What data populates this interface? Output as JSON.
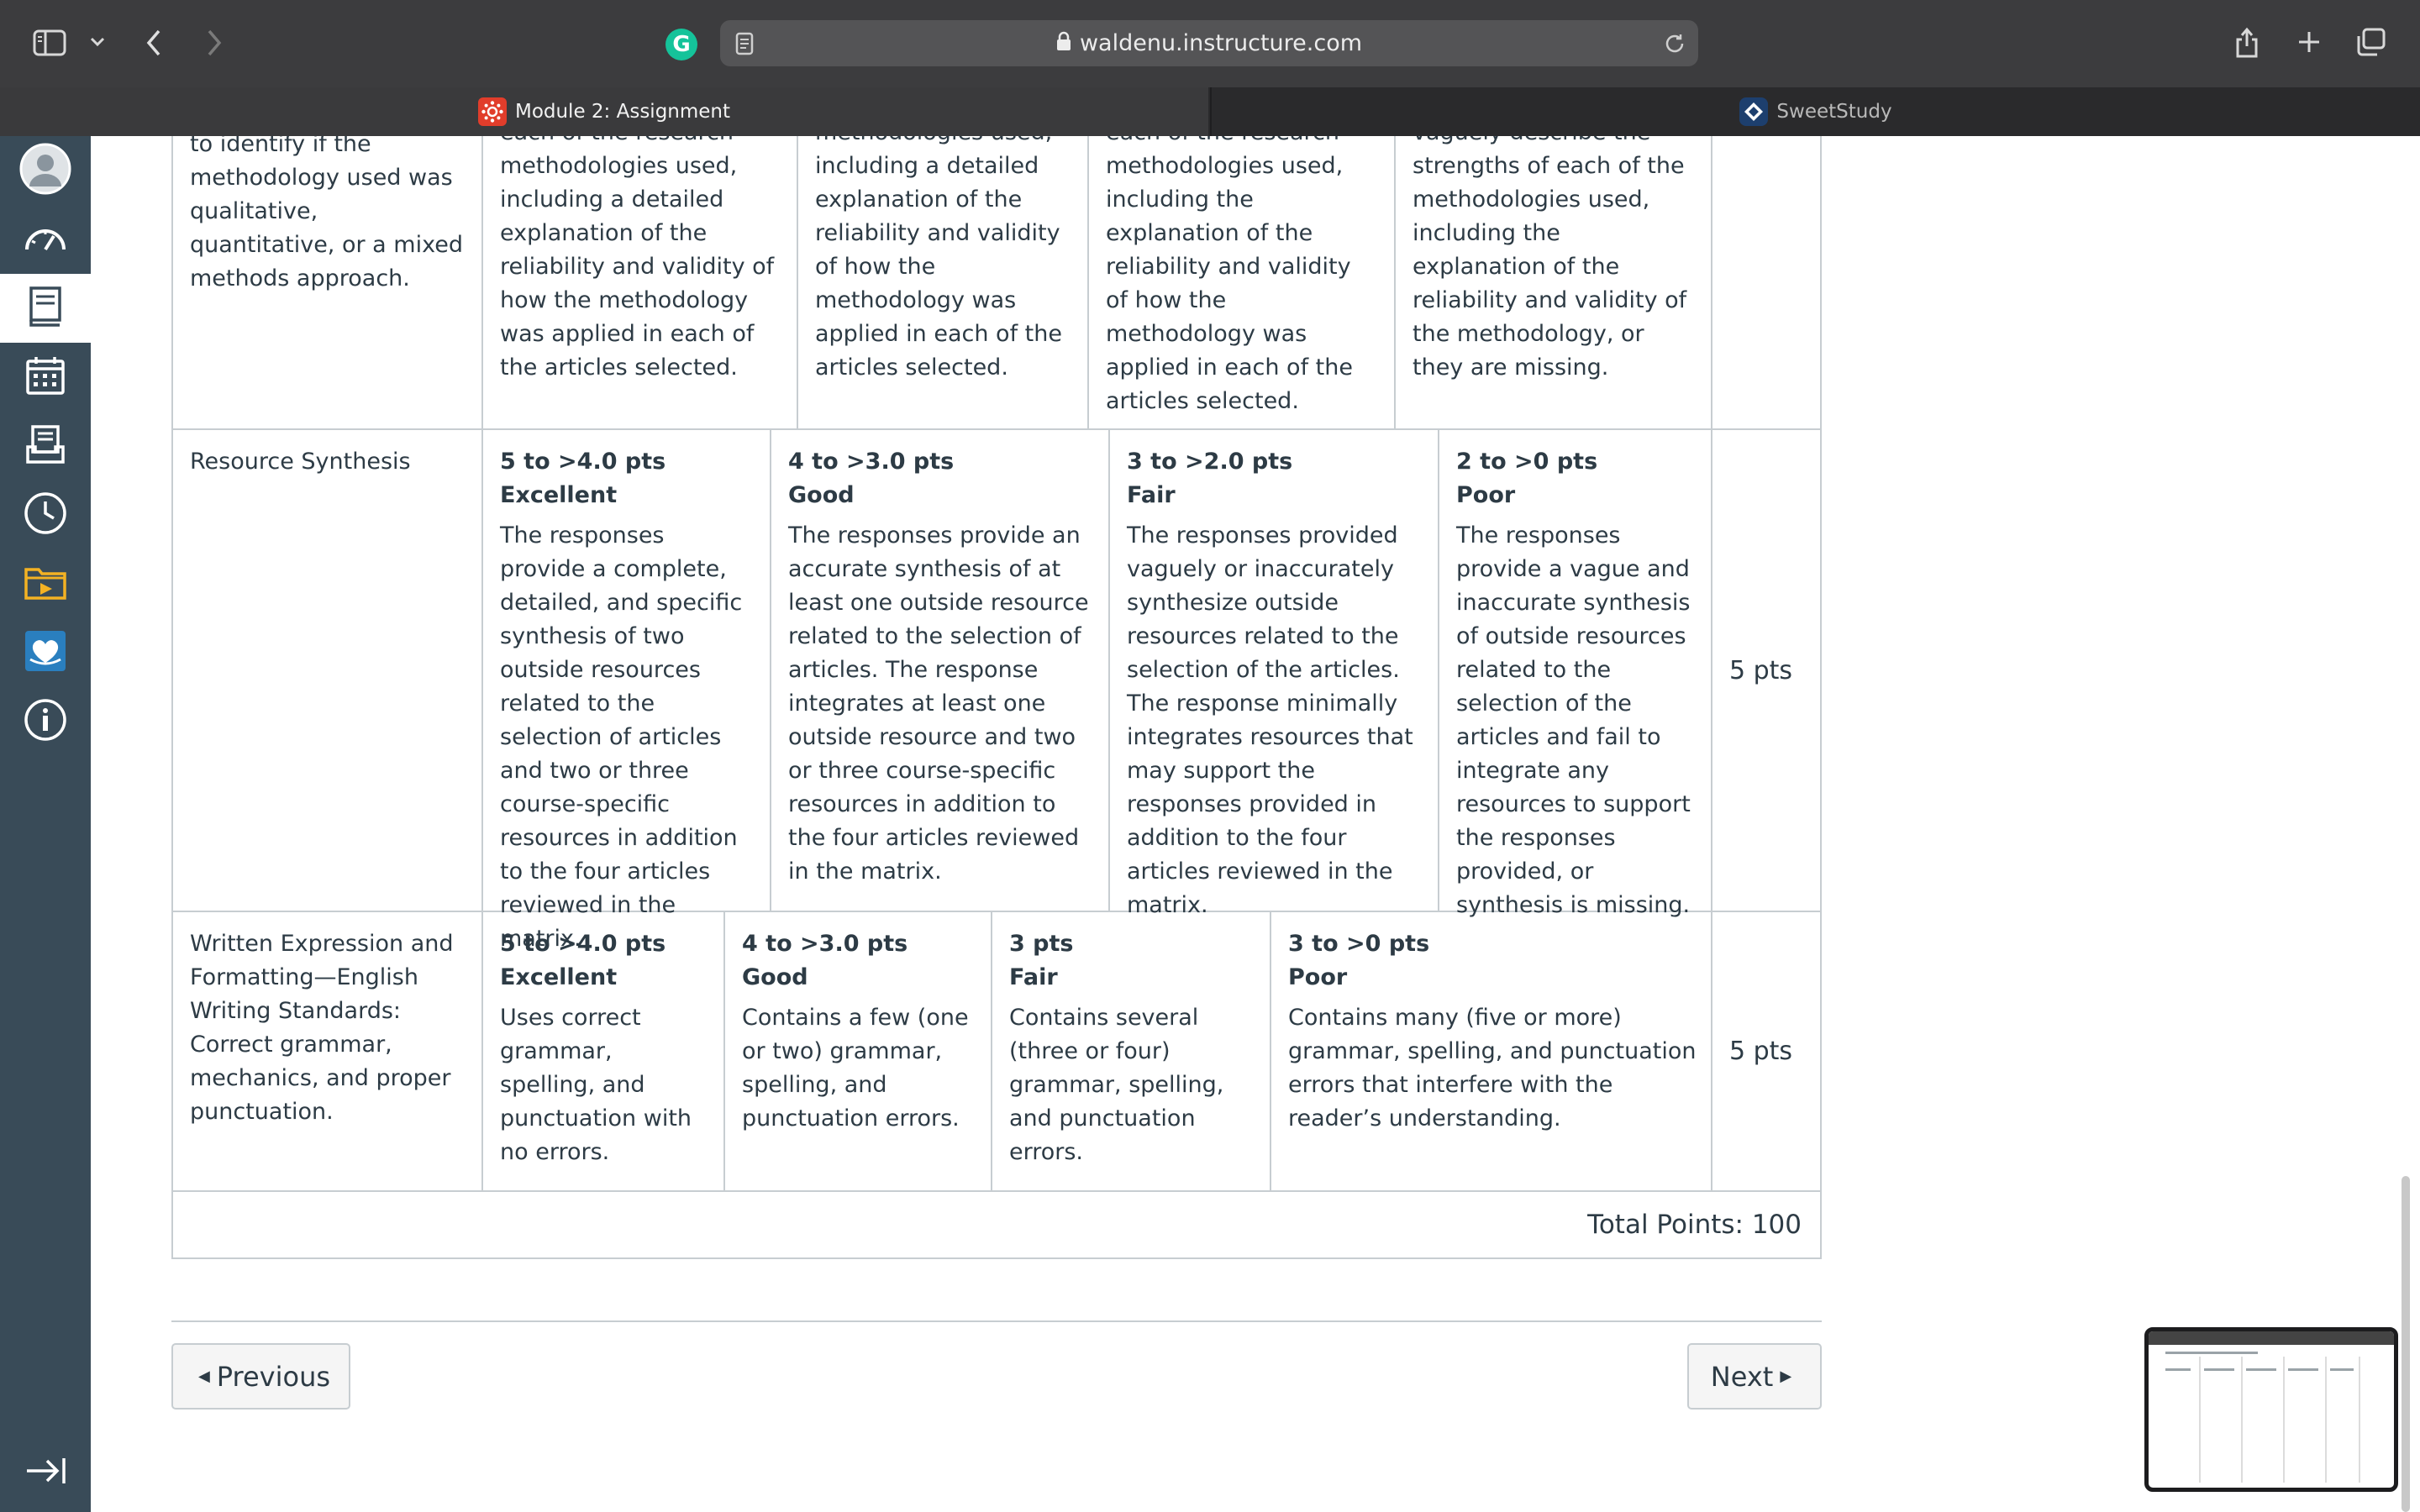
{
  "browser": {
    "url": "waldenu.instructure.com",
    "tabs": [
      {
        "label": "Module 2: Assignment",
        "active": true
      },
      {
        "label": "SweetStudy",
        "active": false
      }
    ]
  },
  "sidebar": {
    "items": [
      {
        "name": "Account",
        "icon": "avatar-icon"
      },
      {
        "name": "Dashboard",
        "icon": "dashboard-icon"
      },
      {
        "name": "Courses",
        "icon": "courses-icon",
        "active": true
      },
      {
        "name": "Calendar",
        "icon": "calendar-icon"
      },
      {
        "name": "Inbox",
        "icon": "inbox-icon"
      },
      {
        "name": "History",
        "icon": "history-icon"
      },
      {
        "name": "Files",
        "icon": "folder-icon"
      },
      {
        "name": "Mental Health",
        "icon": "heart-book-icon"
      },
      {
        "name": "Help",
        "icon": "info-icon"
      }
    ],
    "collapse_icon": "collapse-icon"
  },
  "rubric": {
    "rows": [
      {
        "criterion": "to identify if the methodology used was qualitative, quantitative, or a mixed methods approach.",
        "points": "",
        "ratings": [
          {
            "points": "",
            "name": "",
            "desc": "each of the research methodologies used, including a detailed explanation of the reliability and validity of how the methodology was applied in each of the articles selected."
          },
          {
            "points": "",
            "name": "",
            "desc": "methodologies used, including a detailed explanation of the reliability and validity of how the methodology was applied in each of the articles selected."
          },
          {
            "points": "",
            "name": "",
            "desc": "each of the research methodologies used, including the explanation of the reliability and validity of how the methodology was applied in each of the articles selected."
          },
          {
            "points": "",
            "name": "",
            "desc": "vaguely describe the strengths of each of the methodologies used, including the explanation of the reliability and validity of the methodology, or they are missing."
          }
        ]
      },
      {
        "criterion": "Resource Synthesis",
        "points": "5 pts",
        "ratings": [
          {
            "points": "5 to >4.0 pts",
            "name": "Excellent",
            "desc": "The responses provide a complete, detailed, and specific synthesis of two outside resources related to the selection of articles and two or three course-specific resources in addition to the four articles reviewed in the matrix."
          },
          {
            "points": "4 to >3.0 pts",
            "name": "Good",
            "desc": "The responses provide an accurate synthesis of at least one outside resource related to the selection of articles. The response integrates at least one outside resource and two or three course-specific resources in addition to the four articles reviewed in the matrix."
          },
          {
            "points": "3 to >2.0 pts",
            "name": "Fair",
            "desc": "The responses provided vaguely or inaccurately synthesize outside resources related to the selection of the articles. The response minimally integrates resources that may support the responses provided in addition to the four articles reviewed in the matrix."
          },
          {
            "points": "2 to >0 pts",
            "name": "Poor",
            "desc": "The responses provide a vague and inaccurate synthesis of outside resources related to the selection of the articles and fail to integrate any resources to support the responses provided, or synthesis is missing."
          }
        ]
      },
      {
        "criterion": "Written Expression and Formatting—English Writing Standards: Correct grammar, mechanics, and proper punctuation.",
        "points": "5 pts",
        "ratings": [
          {
            "points": "5 to >4.0 pts",
            "name": "Excellent",
            "desc": "Uses correct grammar, spelling, and punctuation with no errors."
          },
          {
            "points": "4 to >3.0 pts",
            "name": "Good",
            "desc": "Contains a few (one or two) grammar, spelling, and punctuation errors."
          },
          {
            "points": "3 pts",
            "name": "Fair",
            "desc": "Contains several (three or four) grammar, spelling, and punctuation errors."
          },
          {
            "points": "3 to >0 pts",
            "name": "Poor",
            "desc": "Contains many (five or more) grammar, spelling, and punctuation errors that interfere with the reader’s understanding."
          }
        ]
      }
    ],
    "total": "Total Points: 100"
  },
  "nav": {
    "previous": "Previous",
    "next": "Next"
  },
  "colors": {
    "sidebar": "#394b58",
    "border": "#c7cdd1",
    "text": "#2d3b45",
    "chrome": "#3c3c3e"
  }
}
